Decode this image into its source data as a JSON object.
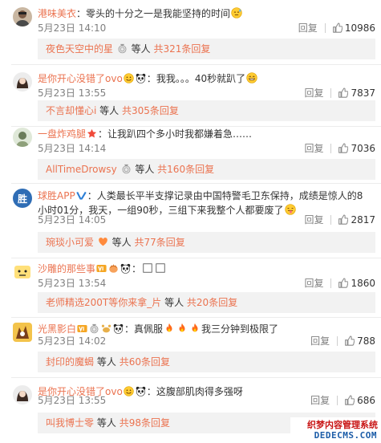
{
  "reply_label": "回复",
  "sub_mid": "等人",
  "comments": [
    {
      "user": "港味美衣",
      "text": "零头的十分之一是我能坚持的时间",
      "time": "5月23日 14:10",
      "likes": "10986",
      "sub_user": "夜色天空中的星",
      "sub_total": "共321条回复"
    },
    {
      "user": "是你开心没错了ovo",
      "text": "我我。。。40秒就趴了",
      "time": "5月23日 13:55",
      "likes": "7837",
      "sub_user": "不言却懂心i",
      "sub_total": "共305条回复"
    },
    {
      "user": "一盘炸鸡腿",
      "text": "让我趴四个多小时我都嫌着急……",
      "time": "5月23日 14:14",
      "likes": "7036",
      "sub_user": "AllTimeDrowsy",
      "sub_total": "共160条回复"
    },
    {
      "user": "球胜APP",
      "text": "人类最长平半支撑记录由中国特警毛卫东保持，成绩是惊人的8小时01分，我天，一组90秒，三组下来我整个人都要废了",
      "time": "5月23日 14:05",
      "likes": "2817",
      "sub_user": "琬琰小可爱",
      "sub_total": "共77条回复"
    },
    {
      "user": "沙雕的那些事",
      "text": "",
      "time": "5月23日 13:54",
      "likes": "1860",
      "sub_user": "老师精选200T等你来拿_片",
      "sub_total": "共20条回复"
    },
    {
      "user": "光黑影白",
      "text": "真佩服",
      "text2": "我三分钟到极限了",
      "time": "5月23日 14:02",
      "likes": "788",
      "sub_user": "封印的魔蝎",
      "sub_total": "共60条回复"
    },
    {
      "user": "是你开心没错了ovo",
      "text": "这腹部肌肉得多强呀",
      "time": "5月23日 13:55",
      "likes": "686",
      "sub_user": "叫我博士零",
      "sub_total": "共98条回复"
    }
  ],
  "watermark": {
    "line1": "织梦内容管理系统",
    "line2": "DEDECMS.COM"
  },
  "colors": {
    "username": "#eb7350",
    "meta": "#808080",
    "sub_bg": "#f2f2f2",
    "vip": "#e6a23c",
    "blue_v": "#2c7fd6"
  }
}
